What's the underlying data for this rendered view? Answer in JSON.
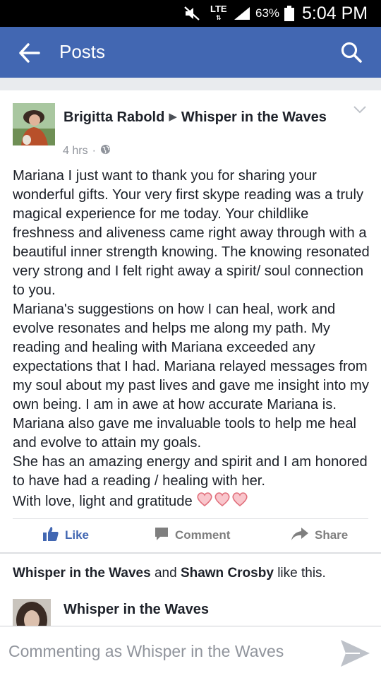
{
  "status_bar": {
    "network": "LTE",
    "battery_percent": "63%",
    "time": "5:04 PM"
  },
  "nav": {
    "title": "Posts",
    "back_icon": "arrow-left-icon",
    "search_icon": "search-icon",
    "bg_color": "#4267b2"
  },
  "post": {
    "author": "Brigitta Rabold",
    "group": "Whisper in the Waves",
    "time_ago": "4 hrs",
    "separator": "·",
    "privacy_icon": "globe-icon",
    "paragraphs": [
      "Mariana I just want to thank you for sharing your wonderful gifts. Your very first skype reading was a truly magical experience for me today. Your childlike freshness and aliveness came right away through with a beautiful inner strength knowing. The knowing resonated very strong and I felt right away a spirit/ soul connection to you.",
      "Mariana's suggestions on how I can heal, work and evolve resonates and helps me along my path. My reading and healing with Mariana exceeded any expectations that I had.  Mariana relayed messages from my soul about my past lives and gave me insight into my own being. I am in awe at how accurate Mariana is.  Mariana also gave me invaluable tools to help me heal and evolve to attain my goals.",
      "She has an amazing energy and spirit and I am honored to have had a reading / healing with her.",
      "With love, light and gratitude"
    ],
    "hearts_icon": "heart-icon"
  },
  "actions": {
    "like": "Like",
    "comment": "Comment",
    "share": "Share",
    "like_color": "#4267b2"
  },
  "likes": {
    "name1": "Whisper in the Waves",
    "joiner": "and",
    "name2": "Shawn Crosby",
    "suffix": "like this."
  },
  "comment": {
    "author": "Whisper in the Waves"
  },
  "composer": {
    "placeholder": "Commenting as Whisper in the Waves",
    "send_icon": "send-icon"
  }
}
